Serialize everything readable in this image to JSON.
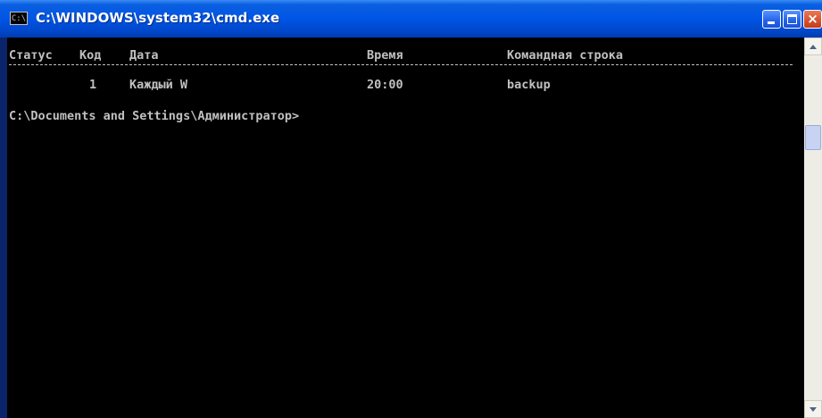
{
  "window": {
    "title": "C:\\WINDOWS\\system32\\cmd.exe",
    "system_icon_text": "C:\\",
    "system_icon": "console-icon",
    "close_glyph": "×"
  },
  "console": {
    "header": {
      "status": "Статус",
      "id": "Код",
      "date": "Дата",
      "time": "Время",
      "command": "Командная строка"
    },
    "rows": [
      {
        "status": "",
        "id": "1",
        "date": "Каждый W",
        "time": "20:00",
        "command": "backup"
      }
    ],
    "prompt": "C:\\Documents and Settings\\Администратор>"
  },
  "colors": {
    "titlebar": "#0055e5",
    "console_background": "#000000",
    "console_text": "#c0c0c0"
  }
}
